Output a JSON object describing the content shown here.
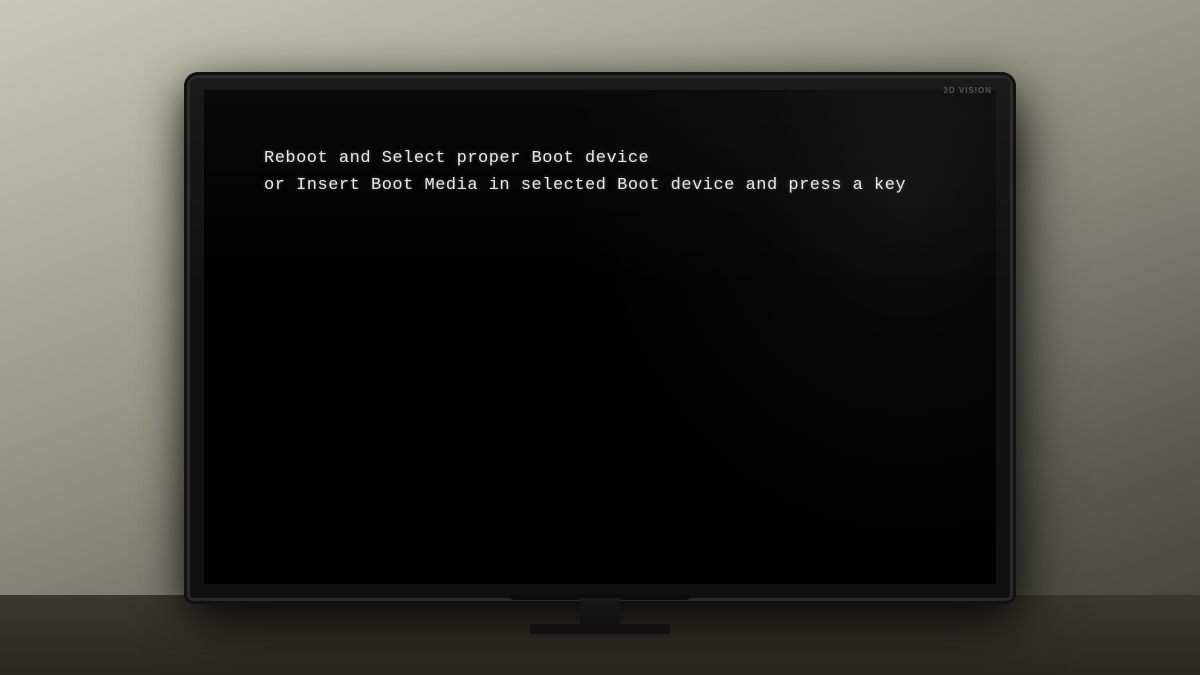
{
  "room": {
    "background_description": "Gray wall with monitor"
  },
  "monitor": {
    "brand_label": "3D VISION",
    "screen": {
      "background_color": "#000000",
      "text_color": "#e8e8e8"
    }
  },
  "bios_message": {
    "line1": "Reboot and Select proper Boot device",
    "line2": "or Insert Boot Media in selected Boot device and press a key"
  }
}
